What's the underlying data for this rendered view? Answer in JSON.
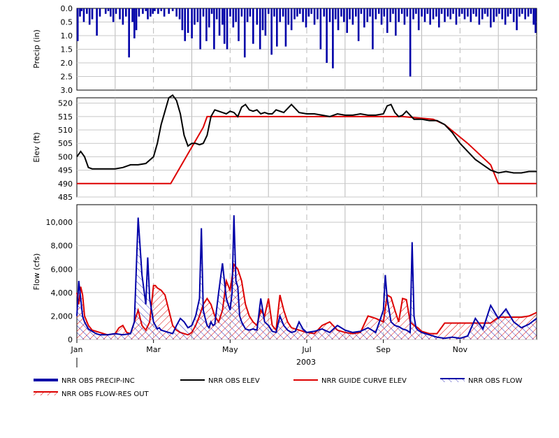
{
  "chart_data": [
    {
      "type": "bar",
      "ylabel": "Precip (in)",
      "ylim": [
        3.0,
        0.0
      ],
      "yticks": [
        "0.0",
        "0.5",
        "1.0",
        "1.5",
        "2.0",
        "2.5",
        "3.0"
      ],
      "grid": true,
      "series": [
        {
          "name": "NRR OBS PRECIP-INC",
          "color": "#0000a8",
          "x": [
            0.02,
            0.08,
            0.12,
            0.18,
            0.26,
            0.33,
            0.4,
            0.52,
            0.6,
            0.75,
            0.82,
            0.88,
            0.95,
            1.02,
            1.12,
            1.2,
            1.28,
            1.36,
            1.45,
            1.5,
            1.55,
            1.62,
            1.72,
            1.8,
            1.85,
            1.92,
            1.98,
            2.03,
            2.12,
            2.2,
            2.28,
            2.4,
            2.5,
            2.6,
            2.68,
            2.75,
            2.82,
            2.9,
            3.0,
            3.07,
            3.15,
            3.22,
            3.3,
            3.38,
            3.45,
            3.52,
            3.58,
            3.65,
            3.72,
            3.8,
            3.85,
            3.92,
            4.0,
            4.08,
            4.15,
            4.22,
            4.3,
            4.38,
            4.45,
            4.52,
            4.6,
            4.7,
            4.78,
            4.85,
            4.92,
            5.0,
            5.08,
            5.15,
            5.22,
            5.3,
            5.38,
            5.45,
            5.52,
            5.6,
            5.68,
            5.75,
            5.82,
            5.9,
            5.98,
            6.05,
            6.12,
            6.2,
            6.28,
            6.36,
            6.45,
            6.52,
            6.6,
            6.68,
            6.75,
            6.82,
            6.9,
            6.97,
            7.05,
            7.12,
            7.2,
            7.28,
            7.35,
            7.42,
            7.5,
            7.58,
            7.65,
            7.72,
            7.8,
            7.88,
            7.95,
            8.02,
            8.1,
            8.18,
            8.25,
            8.32,
            8.4,
            8.48,
            8.55,
            8.62,
            8.7,
            8.78,
            8.85,
            8.92,
            9.0,
            9.08,
            9.15,
            9.22,
            9.3,
            9.38,
            9.45,
            9.52,
            9.6,
            9.68,
            9.75,
            9.82,
            9.9,
            9.98,
            10.05,
            10.12,
            10.2,
            10.28,
            10.35,
            10.42,
            10.5,
            10.58,
            10.65,
            10.72,
            10.8,
            10.88,
            10.95,
            11.02,
            11.1,
            11.18,
            11.25,
            11.32,
            11.4,
            11.48,
            11.55,
            11.62,
            11.7,
            11.78,
            11.85,
            11.92,
            11.97
          ],
          "values": [
            1.2,
            0.3,
            0.1,
            0.5,
            0.2,
            0.6,
            0.4,
            1.0,
            0.3,
            0.2,
            0.1,
            0.3,
            0.5,
            0.2,
            0.4,
            0.6,
            0.3,
            1.8,
            0.5,
            1.1,
            0.8,
            0.3,
            0.2,
            0.1,
            0.4,
            0.3,
            0.2,
            0.1,
            0.2,
            0.1,
            0.3,
            0.2,
            0.1,
            0.3,
            0.4,
            0.8,
            1.2,
            0.9,
            1.1,
            0.6,
            0.5,
            1.5,
            0.3,
            1.2,
            0.7,
            0.2,
            1.5,
            0.4,
            1.0,
            0.6,
            1.3,
            1.5,
            0.3,
            0.7,
            0.5,
            1.2,
            0.3,
            1.8,
            0.5,
            0.3,
            1.3,
            0.6,
            1.5,
            0.8,
            1.0,
            0.2,
            1.7,
            0.3,
            1.4,
            0.5,
            0.3,
            1.4,
            0.6,
            0.8,
            0.4,
            0.3,
            0.2,
            0.5,
            0.7,
            0.3,
            0.2,
            0.6,
            0.4,
            1.5,
            0.3,
            2.0,
            0.5,
            2.2,
            0.4,
            0.8,
            0.3,
            0.5,
            0.9,
            0.4,
            0.6,
            0.3,
            1.2,
            0.2,
            0.7,
            0.5,
            0.3,
            1.5,
            0.4,
            0.2,
            0.6,
            0.3,
            0.9,
            0.5,
            0.2,
            1.0,
            0.5,
            0.2,
            0.6,
            0.3,
            2.5,
            0.4,
            0.2,
            0.8,
            0.3,
            0.5,
            0.2,
            0.6,
            0.4,
            0.3,
            0.7,
            0.2,
            0.5,
            0.3,
            0.4,
            0.2,
            0.6,
            0.3,
            0.2,
            0.4,
            0.3,
            0.5,
            0.2,
            0.3,
            0.6,
            0.4,
            0.2,
            0.3,
            0.7,
            0.5,
            0.3,
            0.2,
            0.4,
            0.6,
            0.3,
            0.2,
            0.5,
            0.8,
            0.3,
            0.2,
            0.4,
            0.3,
            0.2,
            0.6,
            0.9
          ]
        }
      ]
    },
    {
      "type": "line",
      "ylabel": "Elev (ft)",
      "ylim": [
        485,
        522
      ],
      "yticks": [
        "485",
        "490",
        "495",
        "500",
        "505",
        "510",
        "515",
        "520"
      ],
      "grid": true,
      "series": [
        {
          "name": "NRR OBS ELEV",
          "color": "#000000",
          "x": [
            0.0,
            0.1,
            0.2,
            0.3,
            0.4,
            0.6,
            0.8,
            1.0,
            1.2,
            1.4,
            1.6,
            1.8,
            2.0,
            2.1,
            2.2,
            2.3,
            2.4,
            2.5,
            2.6,
            2.7,
            2.8,
            2.9,
            3.0,
            3.1,
            3.2,
            3.3,
            3.4,
            3.5,
            3.6,
            3.7,
            3.8,
            3.9,
            4.0,
            4.1,
            4.2,
            4.3,
            4.4,
            4.5,
            4.6,
            4.7,
            4.8,
            4.9,
            5.0,
            5.1,
            5.2,
            5.4,
            5.6,
            5.8,
            6.0,
            6.2,
            6.4,
            6.6,
            6.8,
            7.0,
            7.2,
            7.4,
            7.6,
            7.8,
            8.0,
            8.1,
            8.2,
            8.3,
            8.4,
            8.5,
            8.6,
            8.7,
            8.8,
            9.0,
            9.2,
            9.4,
            9.6,
            9.8,
            10.0,
            10.2,
            10.4,
            10.6,
            10.8,
            11.0,
            11.2,
            11.4,
            11.6,
            11.8,
            12.0
          ],
          "values": [
            500,
            502,
            500,
            496,
            495.5,
            495.5,
            495.5,
            495.5,
            496,
            497,
            497,
            497.5,
            500,
            505,
            512,
            517,
            522,
            523,
            521,
            516,
            508,
            504,
            505,
            505,
            504.5,
            505,
            508,
            515,
            517.5,
            517,
            516.5,
            516,
            517,
            516.5,
            515,
            518.5,
            519.5,
            517.5,
            517,
            517.5,
            516,
            516.5,
            516,
            516,
            517.5,
            516.5,
            519.5,
            516.5,
            516,
            516,
            515.5,
            515,
            516,
            515.5,
            515.5,
            516,
            515.5,
            515.5,
            516,
            519,
            519.5,
            516.5,
            515,
            515.5,
            517,
            515.5,
            514,
            514,
            513.5,
            513.5,
            512,
            509,
            505,
            502,
            499,
            497,
            495,
            494,
            494.5,
            494,
            494,
            494.5,
            494.5
          ]
        },
        {
          "name": "NRR GUIDE CURVE ELEV",
          "color": "#dd0000",
          "x": [
            0.0,
            2.4,
            2.45,
            3.3,
            3.4,
            5.0,
            7.0,
            8.3,
            8.5,
            9.3,
            9.6,
            10.2,
            10.8,
            11.0,
            12.0
          ],
          "values": [
            490,
            490,
            490,
            511,
            515,
            515,
            515,
            515,
            515,
            514,
            512,
            505,
            497,
            490,
            490
          ]
        }
      ]
    },
    {
      "type": "area",
      "ylabel": "Flow (cfs)",
      "ylim": [
        0,
        11500
      ],
      "yticks": [
        "0",
        "2,000",
        "4,000",
        "6,000",
        "8,000",
        "10,000"
      ],
      "grid": true,
      "xticks": [
        "Jan",
        "Mar",
        "May",
        "Jul",
        "Sep",
        "Nov"
      ],
      "xlabel": "2003",
      "series": [
        {
          "name": "NRR OBS FLOW",
          "color": "#0000a8",
          "x": [
            0.0,
            0.05,
            0.1,
            0.15,
            0.2,
            0.3,
            0.4,
            0.5,
            0.6,
            0.8,
            1.0,
            1.2,
            1.4,
            1.5,
            1.6,
            1.7,
            1.8,
            1.85,
            1.9,
            1.95,
            2.0,
            2.05,
            2.1,
            2.15,
            2.2,
            2.3,
            2.4,
            2.5,
            2.6,
            2.7,
            2.8,
            2.9,
            3.0,
            3.1,
            3.2,
            3.25,
            3.3,
            3.35,
            3.4,
            3.45,
            3.5,
            3.55,
            3.6,
            3.7,
            3.8,
            3.9,
            4.0,
            4.05,
            4.1,
            4.15,
            4.2,
            4.25,
            4.3,
            4.35,
            4.4,
            4.5,
            4.6,
            4.7,
            4.8,
            4.9,
            5.0,
            5.1,
            5.2,
            5.3,
            5.4,
            5.5,
            5.6,
            5.7,
            5.8,
            5.9,
            6.0,
            6.2,
            6.4,
            6.6,
            6.8,
            7.0,
            7.2,
            7.4,
            7.6,
            7.8,
            8.0,
            8.05,
            8.1,
            8.2,
            8.3,
            8.4,
            8.5,
            8.6,
            8.7,
            8.75,
            8.8,
            8.85,
            8.9,
            9.0,
            9.2,
            9.4,
            9.6,
            9.8,
            10.0,
            10.2,
            10.4,
            10.6,
            10.8,
            11.0,
            11.2,
            11.4,
            11.6,
            11.8,
            12.0
          ],
          "values": [
            2000,
            5000,
            3500,
            2000,
            1500,
            900,
            700,
            500,
            400,
            400,
            500,
            400,
            500,
            1500,
            10400,
            5500,
            3000,
            7000,
            3500,
            2500,
            1500,
            1200,
            900,
            1000,
            800,
            700,
            600,
            500,
            1200,
            1800,
            1500,
            1000,
            1200,
            2000,
            3500,
            9500,
            2500,
            1800,
            1200,
            1000,
            1500,
            1200,
            1300,
            4000,
            6500,
            3500,
            2500,
            4000,
            10600,
            5000,
            4500,
            2000,
            1500,
            1200,
            900,
            800,
            900,
            800,
            3500,
            1500,
            1200,
            700,
            600,
            2000,
            1200,
            800,
            600,
            700,
            1500,
            900,
            600,
            700,
            900,
            600,
            1200,
            800,
            600,
            700,
            1000,
            600,
            2500,
            5500,
            3500,
            1500,
            1200,
            1100,
            900,
            800,
            600,
            8300,
            2000,
            1000,
            800,
            600,
            400,
            200,
            100,
            200,
            100,
            300,
            1800,
            900,
            2900,
            1800,
            2600,
            1500,
            1000,
            1300,
            1800
          ]
        },
        {
          "name": "NRR OBS FLOW-RES OUT",
          "color": "#dd0000",
          "x": [
            0.0,
            0.05,
            0.1,
            0.15,
            0.2,
            0.3,
            0.4,
            0.6,
            0.8,
            1.0,
            1.1,
            1.2,
            1.3,
            1.4,
            1.5,
            1.6,
            1.7,
            1.8,
            1.9,
            2.0,
            2.05,
            2.1,
            2.2,
            2.3,
            2.4,
            2.5,
            2.6,
            2.7,
            2.8,
            2.9,
            3.0,
            3.1,
            3.2,
            3.3,
            3.4,
            3.5,
            3.6,
            3.7,
            3.8,
            3.9,
            4.0,
            4.1,
            4.2,
            4.3,
            4.4,
            4.5,
            4.6,
            4.7,
            4.8,
            4.9,
            5.0,
            5.1,
            5.2,
            5.3,
            5.4,
            5.5,
            5.6,
            5.8,
            6.0,
            6.2,
            6.4,
            6.6,
            6.8,
            7.0,
            7.2,
            7.4,
            7.6,
            7.8,
            8.0,
            8.1,
            8.2,
            8.3,
            8.4,
            8.5,
            8.6,
            8.7,
            8.8,
            8.9,
            9.0,
            9.2,
            9.4,
            9.6,
            9.8,
            10.0,
            10.2,
            10.4,
            10.6,
            10.8,
            11.0,
            11.2,
            11.4,
            11.6,
            11.8,
            12.0
          ],
          "values": [
            4000,
            3000,
            4500,
            3800,
            2000,
            1200,
            800,
            600,
            400,
            500,
            1000,
            1200,
            600,
            500,
            1500,
            2500,
            1200,
            800,
            1500,
            4600,
            4600,
            4400,
            4200,
            3800,
            2500,
            1200,
            800,
            600,
            500,
            400,
            600,
            1200,
            2000,
            3000,
            3500,
            3000,
            2000,
            1500,
            2500,
            5000,
            4200,
            6400,
            6000,
            5000,
            3000,
            2000,
            1500,
            1200,
            2500,
            2000,
            3500,
            1200,
            800,
            3800,
            2500,
            1500,
            1000,
            800,
            600,
            500,
            1200,
            1500,
            800,
            600,
            500,
            600,
            2000,
            1800,
            1500,
            3800,
            3600,
            2500,
            1500,
            3500,
            3400,
            1500,
            1200,
            1000,
            700,
            500,
            500,
            1400,
            1400,
            1400,
            1400,
            1400,
            1400,
            1400,
            1900,
            1900,
            1900,
            1900,
            2000,
            2300
          ]
        }
      ]
    }
  ],
  "legend": [
    {
      "label": "NRR OBS PRECIP-INC",
      "style": "thick-blue"
    },
    {
      "label": "NRR OBS ELEV",
      "style": "black-line"
    },
    {
      "label": "NRR GUIDE CURVE ELEV",
      "style": "red-line"
    },
    {
      "label": "NRR OBS FLOW",
      "style": "blue-hatch"
    },
    {
      "label": "NRR OBS FLOW-RES OUT",
      "style": "red-hatch"
    }
  ]
}
